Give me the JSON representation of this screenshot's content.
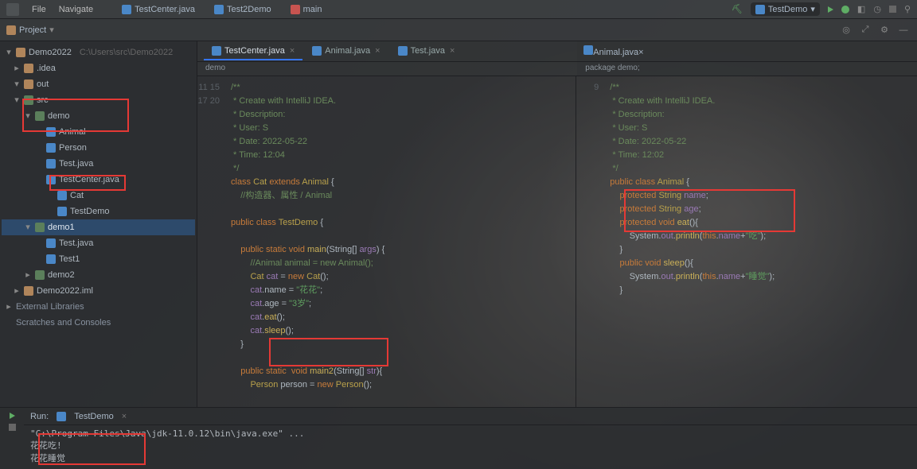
{
  "menubar": {
    "items": [
      "File",
      "Navigate"
    ],
    "topTabs": [
      {
        "icon": "ico-class",
        "label": "TestCenter.java"
      },
      {
        "icon": "ico-class",
        "label": "Test2Demo"
      },
      {
        "icon": "ico-red",
        "label": "main"
      }
    ],
    "runConfig": "TestDemo",
    "rightIcons": [
      "run",
      "debug",
      "stop"
    ]
  },
  "breadcrumb": {
    "project": "Project",
    "chev": "▾"
  },
  "toolbar": {
    "icons": [
      "⚙",
      "⟳",
      "⚙",
      "—"
    ]
  },
  "tree": [
    {
      "d": 0,
      "arrow": "▾",
      "icon": "ico-folder",
      "label": "Demo2022",
      "tail": "C:\\Users\\src\\Demo2022"
    },
    {
      "d": 1,
      "arrow": "▸",
      "icon": "ico-folder",
      "label": ".idea"
    },
    {
      "d": 1,
      "arrow": "▾",
      "icon": "ico-folder",
      "label": "out"
    },
    {
      "d": 1,
      "arrow": "▾",
      "icon": "ico-pkg",
      "label": "src"
    },
    {
      "d": 2,
      "arrow": "▾",
      "icon": "ico-pkg",
      "label": "demo",
      "boxed": true
    },
    {
      "d": 3,
      "arrow": "",
      "icon": "ico-class",
      "label": "Animal",
      "boxed": true
    },
    {
      "d": 3,
      "arrow": "",
      "icon": "ico-class",
      "label": "Person"
    },
    {
      "d": 3,
      "arrow": "",
      "icon": "ico-class",
      "label": "Test.java"
    },
    {
      "d": 3,
      "arrow": "",
      "icon": "ico-class",
      "label": "TestCenter.java"
    },
    {
      "d": 4,
      "arrow": "",
      "icon": "ico-class",
      "label": "Cat",
      "boxed": true
    },
    {
      "d": 4,
      "arrow": "",
      "icon": "ico-class",
      "label": "TestDemo"
    },
    {
      "d": 2,
      "arrow": "▾",
      "icon": "ico-pkg",
      "label": "demo1",
      "sel": true
    },
    {
      "d": 3,
      "arrow": "",
      "icon": "ico-class",
      "label": "Test.java"
    },
    {
      "d": 3,
      "arrow": "",
      "icon": "ico-class",
      "label": "Test1"
    },
    {
      "d": 2,
      "arrow": "▸",
      "icon": "ico-pkg",
      "label": "demo2"
    },
    {
      "d": 1,
      "arrow": "▸",
      "icon": "ico-folder",
      "label": "Demo2022.iml"
    },
    {
      "d": 0,
      "arrow": "▸",
      "icon": "",
      "label": "External Libraries",
      "lib": true
    },
    {
      "d": 0,
      "arrow": "",
      "icon": "",
      "label": "Scratches and Consoles",
      "lib": true
    }
  ],
  "editorTabsLeft": [
    {
      "icon": "ico-class",
      "label": "TestCenter.java",
      "active": true
    },
    {
      "icon": "ico-class",
      "label": "Animal.java"
    },
    {
      "icon": "ico-class",
      "label": "Test.java"
    }
  ],
  "editorTabsRight": [
    {
      "icon": "ico-class",
      "label": "Animal.java",
      "active": true
    }
  ],
  "crumbLeft": "demo",
  "crumbRight": "package demo;",
  "leftCode": [
    {
      "n": "",
      "cls": "c-cm",
      "t": "/**"
    },
    {
      "n": "",
      "cls": "c-cm",
      "t": " * Create with IntelliJ IDEA."
    },
    {
      "n": "",
      "cls": "c-cm",
      "t": " * Description:"
    },
    {
      "n": "",
      "cls": "c-cm",
      "t": " * User: S"
    },
    {
      "n": "",
      "cls": "c-cm",
      "t": " * Date: 2022-05-22"
    },
    {
      "n": "",
      "cls": "c-cm",
      "t": " * Time: 12:04"
    },
    {
      "n": "",
      "cls": "c-cm",
      "t": " */"
    },
    {
      "n": "11",
      "cls": "",
      "t": "<kw>class</kw> <ty>Cat</ty> <kw>extends</kw> <ty>Animal</ty> {"
    },
    {
      "n": "",
      "cls": "c-cm",
      "t": "    //构造器、属性 / Animal"
    },
    {
      "n": "",
      "cls": "",
      "t": ""
    },
    {
      "n": "15",
      "cls": "",
      "t": "<kw>public</kw> <kw>class</kw> <ty>TestDemo</ty> {"
    },
    {
      "n": "",
      "cls": "",
      "t": ""
    },
    {
      "n": "",
      "cls": "",
      "t": "    <kw>public static void</kw> <fn>main</fn>(String[] <id>args</id>) {"
    },
    {
      "n": "17",
      "cls": "c-cm",
      "t": "        //Animal animal = new Animal();"
    },
    {
      "n": "",
      "cls": "",
      "t": "        <ty>Cat</ty> <id>cat</id> = <kw>new</kw> <ty>Cat</ty>();"
    },
    {
      "n": "20",
      "cls": "",
      "t": "        <id>cat</id>.name = <str>\"花花\"</str>;",
      "boxed": true
    },
    {
      "n": "",
      "cls": "",
      "t": "        <id>cat</id>.age = <str>\"3岁\"</str>;",
      "boxed2": true
    },
    {
      "n": "",
      "cls": "",
      "t": "        <id>cat</id>.<fn>eat</fn>();"
    },
    {
      "n": "",
      "cls": "",
      "t": "        <id>cat</id>.<fn>sleep</fn>();"
    },
    {
      "n": "",
      "cls": "",
      "t": "    }"
    },
    {
      "n": "",
      "cls": "",
      "t": ""
    },
    {
      "n": "",
      "cls": "",
      "t": "    <kw>public static</kw>  <kw>void</kw> <fn>main2</fn>(String[] <id>str</id>){"
    },
    {
      "n": "",
      "cls": "",
      "t": "        <ty>Person</ty> person = <kw>new</kw> <ty>Person</ty>();"
    }
  ],
  "rightCode": [
    {
      "n": "",
      "cls": "c-cm",
      "t": "/**"
    },
    {
      "n": "",
      "cls": "c-cm",
      "t": " * Create with IntelliJ IDEA."
    },
    {
      "n": "",
      "cls": "c-cm",
      "t": " * Description:"
    },
    {
      "n": "",
      "cls": "c-cm",
      "t": " * User: S"
    },
    {
      "n": "",
      "cls": "c-cm",
      "t": " * Date: 2022-05-22"
    },
    {
      "n": "",
      "cls": "c-cm",
      "t": " * Time: 12:02"
    },
    {
      "n": "",
      "cls": "c-cm",
      "t": " */"
    },
    {
      "n": "9",
      "cls": "",
      "t": "<kw>public class</kw> <ty>Animal</ty> {"
    },
    {
      "n": "",
      "cls": "",
      "t": "    <kw>protected</kw> <ty>String</ty> <id>name</id>;",
      "boxed": true
    },
    {
      "n": "",
      "cls": "",
      "t": "    <kw>protected</kw> <ty>String</ty> <id>age</id>;",
      "boxed2": true
    },
    {
      "n": "",
      "cls": "",
      "t": "    <kw>protected</kw> <kw>void</kw> <fn>eat</fn>(){",
      "boxed3": true
    },
    {
      "n": "",
      "cls": "",
      "t": "        System.<id>out</id>.<fn>println</fn>(<kw>this</kw>.<id>name</id>+<str>\"吃\"</str>);"
    },
    {
      "n": "",
      "cls": "",
      "t": "    }"
    },
    {
      "n": "",
      "cls": "",
      "t": "    <kw>public void</kw> <fn>sleep</fn>(){"
    },
    {
      "n": "",
      "cls": "",
      "t": "        System.<id>out</id>.<fn>println</fn>(<kw>this</kw>.<id>name</id>+<str>\"睡觉\"</str>);"
    },
    {
      "n": "",
      "cls": "",
      "t": "    }"
    }
  ],
  "run": {
    "tabLabel": "Run:",
    "tabName": "TestDemo",
    "lines": [
      "\"C:\\Program Files\\Java\\jdk-11.0.12\\bin\\java.exe\" ...",
      "花花吃!",
      "花花睡觉"
    ]
  }
}
